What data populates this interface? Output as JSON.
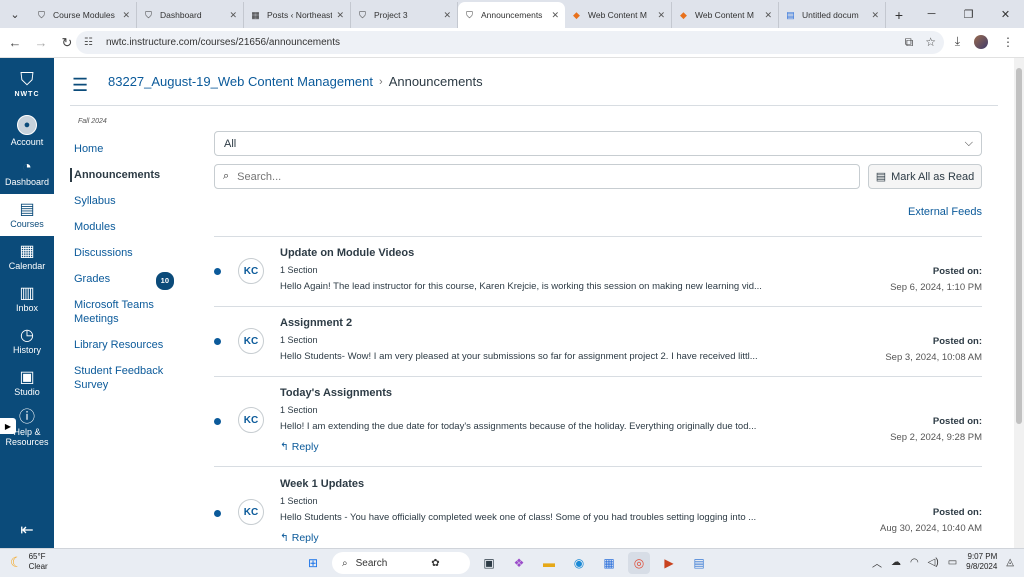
{
  "browser": {
    "tabs": [
      {
        "label": "Course Modules",
        "icon": "canvas-icon",
        "active": false
      },
      {
        "label": "Dashboard",
        "icon": "canvas-icon",
        "active": false
      },
      {
        "label": "Posts ‹ Northeast",
        "icon": "wordpress-icon",
        "active": false
      },
      {
        "label": "Project 3",
        "icon": "canvas-icon",
        "active": false
      },
      {
        "label": "Announcements",
        "icon": "canvas-icon",
        "active": true
      },
      {
        "label": "Web Content M",
        "icon": "orange-diamond-icon",
        "active": false
      },
      {
        "label": "Web Content M",
        "icon": "orange-diamond-icon",
        "active": false
      },
      {
        "label": "Untitled docum",
        "icon": "docs-icon",
        "active": false
      }
    ],
    "url": "nwtc.instructure.com/courses/21656/announcements"
  },
  "global_nav": {
    "logo_text": "NWTC",
    "items": [
      {
        "label": "Account",
        "icon": "account-icon"
      },
      {
        "label": "Dashboard",
        "icon": "dashboard-icon"
      },
      {
        "label": "Courses",
        "icon": "courses-icon"
      },
      {
        "label": "Calendar",
        "icon": "calendar-icon"
      },
      {
        "label": "Inbox",
        "icon": "inbox-icon"
      },
      {
        "label": "History",
        "icon": "history-icon"
      },
      {
        "label": "Studio",
        "icon": "studio-icon"
      },
      {
        "label": "Help &",
        "label2": "Resources",
        "icon": "help-icon"
      }
    ]
  },
  "header": {
    "course": "83227_August-19_Web Content Management",
    "page": "Announcements"
  },
  "course_nav": {
    "term": "Fall 2024",
    "items": [
      {
        "label": "Home"
      },
      {
        "label": "Announcements"
      },
      {
        "label": "Syllabus"
      },
      {
        "label": "Modules"
      },
      {
        "label": "Discussions"
      },
      {
        "label": "Grades",
        "badge": "10"
      },
      {
        "label": "Microsoft Teams",
        "label2": "Meetings"
      },
      {
        "label": "Library Resources"
      },
      {
        "label": "Student Feedback",
        "label2": "Survey"
      }
    ]
  },
  "main": {
    "filter_value": "All",
    "search_placeholder": "Search...",
    "mark_all_label": "Mark All as Read",
    "external_feeds": "External Feeds",
    "announcements": [
      {
        "title": "Update on Module Videos",
        "sections": "1 Section",
        "message": "Hello Again! The lead instructor for this course, Karen Krejcie, is working this session on making new learning vid...",
        "posted_label": "Posted on:",
        "posted_date": "Sep 6, 2024, 1:10 PM",
        "initials": "KC",
        "reply": ""
      },
      {
        "title": "Assignment 2",
        "sections": "1 Section",
        "message": "Hello Students- Wow! I am very pleased at your submissions so far for assignment project 2. I have received littl...",
        "posted_label": "Posted on:",
        "posted_date": "Sep 3, 2024, 10:08 AM",
        "initials": "KC",
        "reply": ""
      },
      {
        "title": "Today's Assignments",
        "sections": "1 Section",
        "message": "Hello! I am extending the due date for today's assignments because of the holiday. Everything originally due tod...",
        "posted_label": "Posted on:",
        "posted_date": "Sep 2, 2024, 9:28 PM",
        "initials": "KC",
        "reply": "Reply"
      },
      {
        "title": "Week 1 Updates",
        "sections": "1 Section",
        "message": "Hello Students -  You have officially completed week one of class! Some of you had troubles setting logging into ...",
        "posted_label": "Posted on:",
        "posted_date": "Aug 30, 2024, 10:40 AM",
        "initials": "KC",
        "reply": "Reply"
      }
    ]
  },
  "taskbar": {
    "temp": "65°F",
    "condition": "Clear",
    "search_label": "Search",
    "time": "9:07 PM",
    "date": "9/8/2024"
  },
  "colors": {
    "canvas_nav": "#0b4b7a",
    "link": "#0b5a9a"
  }
}
